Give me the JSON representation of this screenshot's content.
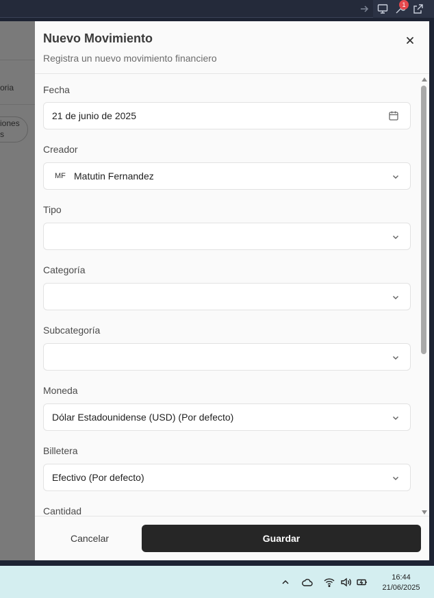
{
  "browser_bar": {
    "notification_count": "1"
  },
  "background_page": {
    "text_1": "oria",
    "text_2": "iones",
    "text_3": "s"
  },
  "dialog": {
    "title": "Nuevo Movimiento",
    "subtitle": "Registra un nuevo movimiento financiero",
    "fields": {
      "fecha": {
        "label": "Fecha",
        "value": "21 de junio de 2025"
      },
      "creador": {
        "label": "Creador",
        "initials": "MF",
        "value": "Matutin Fernandez"
      },
      "tipo": {
        "label": "Tipo",
        "value": ""
      },
      "categoria": {
        "label": "Categoría",
        "value": ""
      },
      "subcategoria": {
        "label": "Subcategoría",
        "value": ""
      },
      "moneda": {
        "label": "Moneda",
        "value": "Dólar Estadounidense (USD) (Por defecto)"
      },
      "billetera": {
        "label": "Billetera",
        "value": "Efectivo (Por defecto)"
      },
      "cantidad": {
        "label": "Cantidad"
      }
    },
    "buttons": {
      "cancel": "Cancelar",
      "save": "Guardar"
    }
  },
  "taskbar": {
    "time": "16:44",
    "date": "21/06/2025"
  },
  "icons": {
    "close": "close-icon",
    "calendar": "calendar-icon",
    "chevron": "chevron-down-icon"
  }
}
